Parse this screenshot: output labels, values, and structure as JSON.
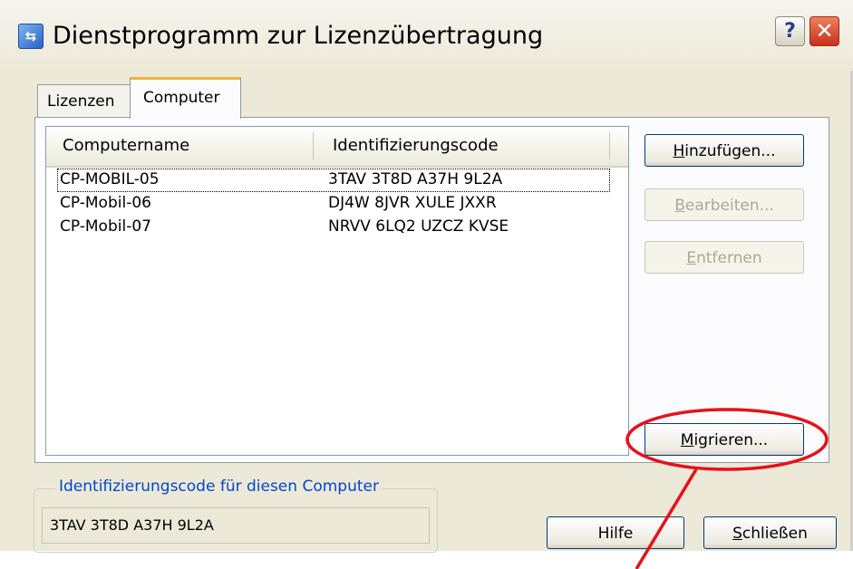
{
  "window": {
    "title": "Dienstprogramm zur Lizenzübertragung",
    "help_glyph": "?",
    "close_glyph": "✕",
    "icon_glyph": "⇆"
  },
  "tabs": [
    {
      "label": "Lizenzen",
      "selected": false
    },
    {
      "label": "Computer",
      "selected": true
    }
  ],
  "list": {
    "columns": [
      "Computername",
      "Identifizierungscode"
    ],
    "rows": [
      {
        "name": "CP-MOBIL-05",
        "code": "3TAV 3T8D A37H 9L2A"
      },
      {
        "name": "CP-Mobil-06",
        "code": "DJ4W 8JVR XULE JXXR"
      },
      {
        "name": "CP-Mobil-07",
        "code": "NRVV 6LQ2 UZCZ KVSE"
      }
    ]
  },
  "buttons": {
    "add": "Hinzufügen...",
    "edit": "Bearbeiten...",
    "remove": "Entfernen",
    "migrate": "Migrieren...",
    "help": "Hilfe",
    "close": "Schließen"
  },
  "this_computer": {
    "legend": "Identifizierungscode für diesen Computer",
    "value": "3TAV 3T8D A37H 9L2A"
  },
  "colors": {
    "annotation": "#e8101a",
    "legend_text": "#0046d5",
    "tab_highlight": "#f4b035"
  }
}
